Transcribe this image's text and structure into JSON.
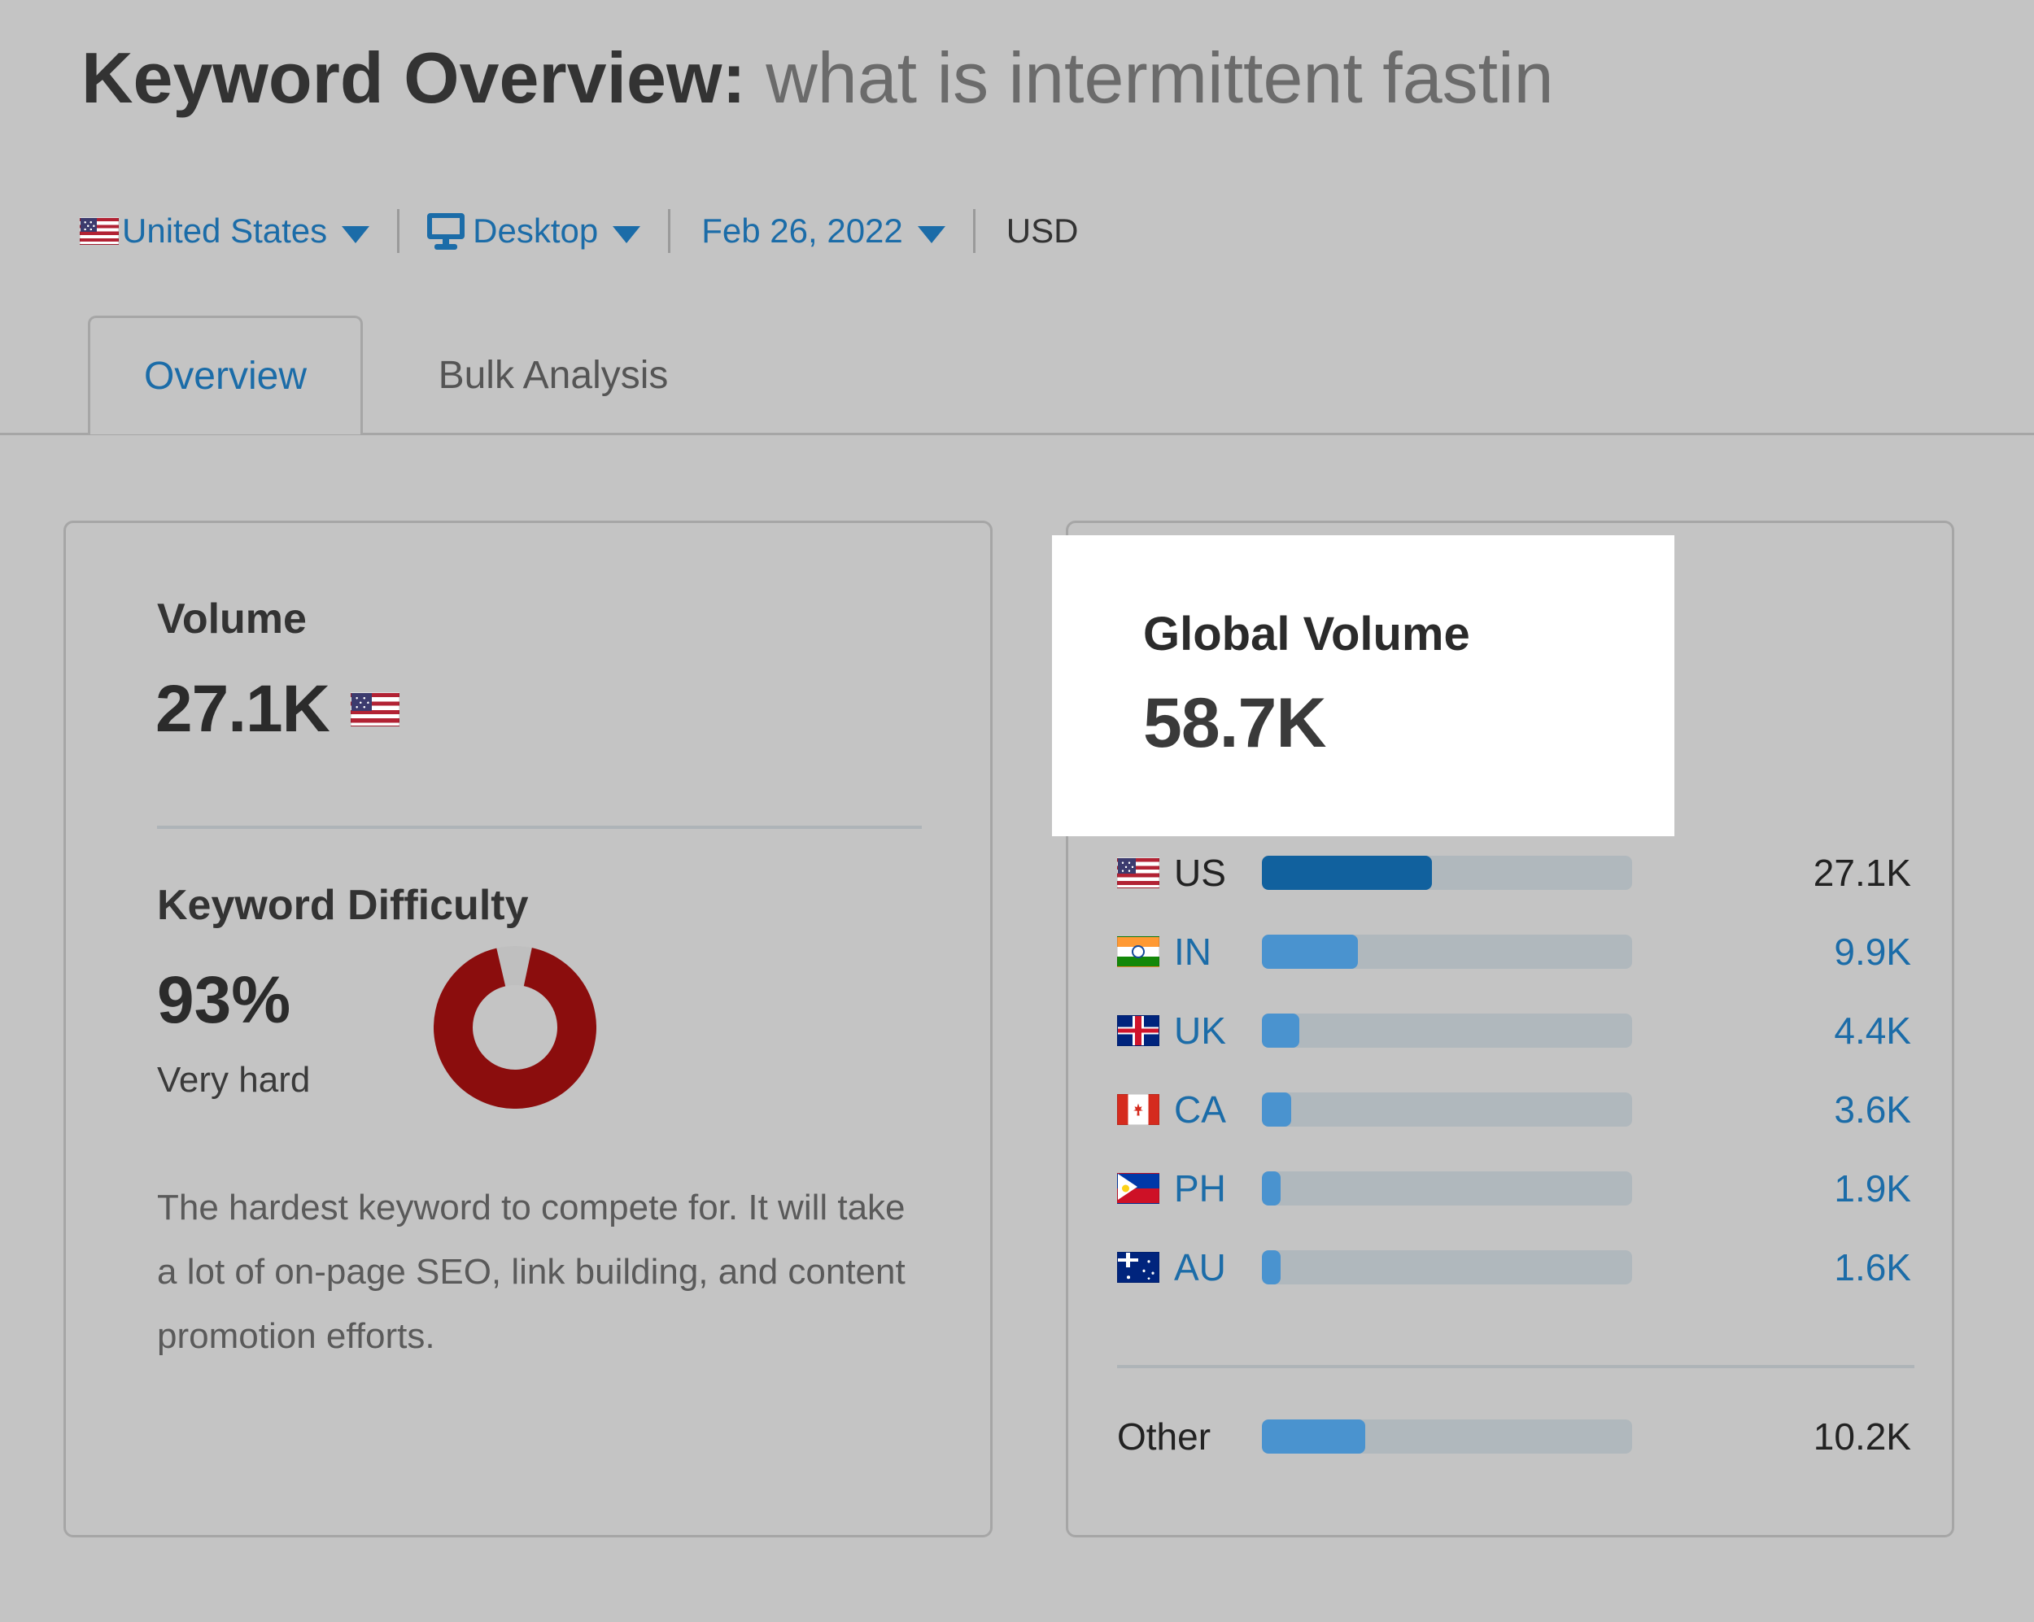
{
  "header": {
    "title_label": "Keyword Overview:",
    "keyword": "what is intermittent fastin"
  },
  "filters": {
    "country": "United States",
    "country_flag_icon": "flag-us-icon",
    "device": "Desktop",
    "device_icon": "monitor-icon",
    "date": "Feb 26, 2022",
    "currency": "USD",
    "chevron_icon": "chevron-down-icon"
  },
  "tabs": [
    {
      "label": "Overview",
      "active": true
    },
    {
      "label": "Bulk Analysis",
      "active": false
    }
  ],
  "volume_card": {
    "volume_label": "Volume",
    "volume_value": "27.1K",
    "volume_flag_icon": "flag-us-icon",
    "difficulty_label": "Keyword Difficulty",
    "difficulty_value": "93%",
    "difficulty_rating": "Very hard",
    "difficulty_description": "The hardest keyword to compete for. It will take a lot of on-page SEO, link building, and content promotion efforts.",
    "difficulty_color": "#8B0D0D",
    "difficulty_track_color": "#bfbfbf"
  },
  "global_volume_card": {
    "title": "Global Volume",
    "value": "58.7K",
    "highlight_background": "#ffffff"
  },
  "chart_data": {
    "type": "bar",
    "title": "Global Volume",
    "orientation": "horizontal",
    "total": "58.7K",
    "categories": [
      "US",
      "IN",
      "UK",
      "CA",
      "PH",
      "AU",
      "Other"
    ],
    "values": [
      27100,
      9900,
      4400,
      3600,
      1900,
      1600,
      10200
    ],
    "value_labels": [
      "27.1K",
      "9.9K",
      "4.4K",
      "3.6K",
      "1.9K",
      "1.6K",
      "10.2K"
    ],
    "bar_fill_percent": [
      46,
      26,
      10,
      8,
      5,
      5,
      28
    ],
    "xlabel": "",
    "ylabel": "",
    "grid": false,
    "legend": "none",
    "colors": {
      "primary_bar": "#11619e",
      "secondary_bar": "#4a93cf",
      "track": "#b0b8bd"
    },
    "rows": [
      {
        "code": "US",
        "flag_icon": "flag-us-icon",
        "value_label": "27.1K",
        "value": 27100,
        "fill_percent": 46,
        "primary": true
      },
      {
        "code": "IN",
        "flag_icon": "flag-in-icon",
        "value_label": "9.9K",
        "value": 9900,
        "fill_percent": 26,
        "primary": false
      },
      {
        "code": "UK",
        "flag_icon": "flag-uk-icon",
        "value_label": "4.4K",
        "value": 4400,
        "fill_percent": 10,
        "primary": false
      },
      {
        "code": "CA",
        "flag_icon": "flag-ca-icon",
        "value_label": "3.6K",
        "value": 3600,
        "fill_percent": 8,
        "primary": false
      },
      {
        "code": "PH",
        "flag_icon": "flag-ph-icon",
        "value_label": "1.9K",
        "value": 1900,
        "fill_percent": 5,
        "primary": false
      },
      {
        "code": "AU",
        "flag_icon": "flag-au-icon",
        "value_label": "1.6K",
        "value": 1600,
        "fill_percent": 5,
        "primary": false
      }
    ],
    "other_row": {
      "label": "Other",
      "value_label": "10.2K",
      "value": 10200,
      "fill_percent": 28
    }
  },
  "colors": {
    "page_background": "#c4c4c4",
    "accent_blue": "#1b6ca8",
    "text_dark": "#2b2b2b",
    "text_muted": "#5a5a5a",
    "border": "#a6a6a6"
  }
}
